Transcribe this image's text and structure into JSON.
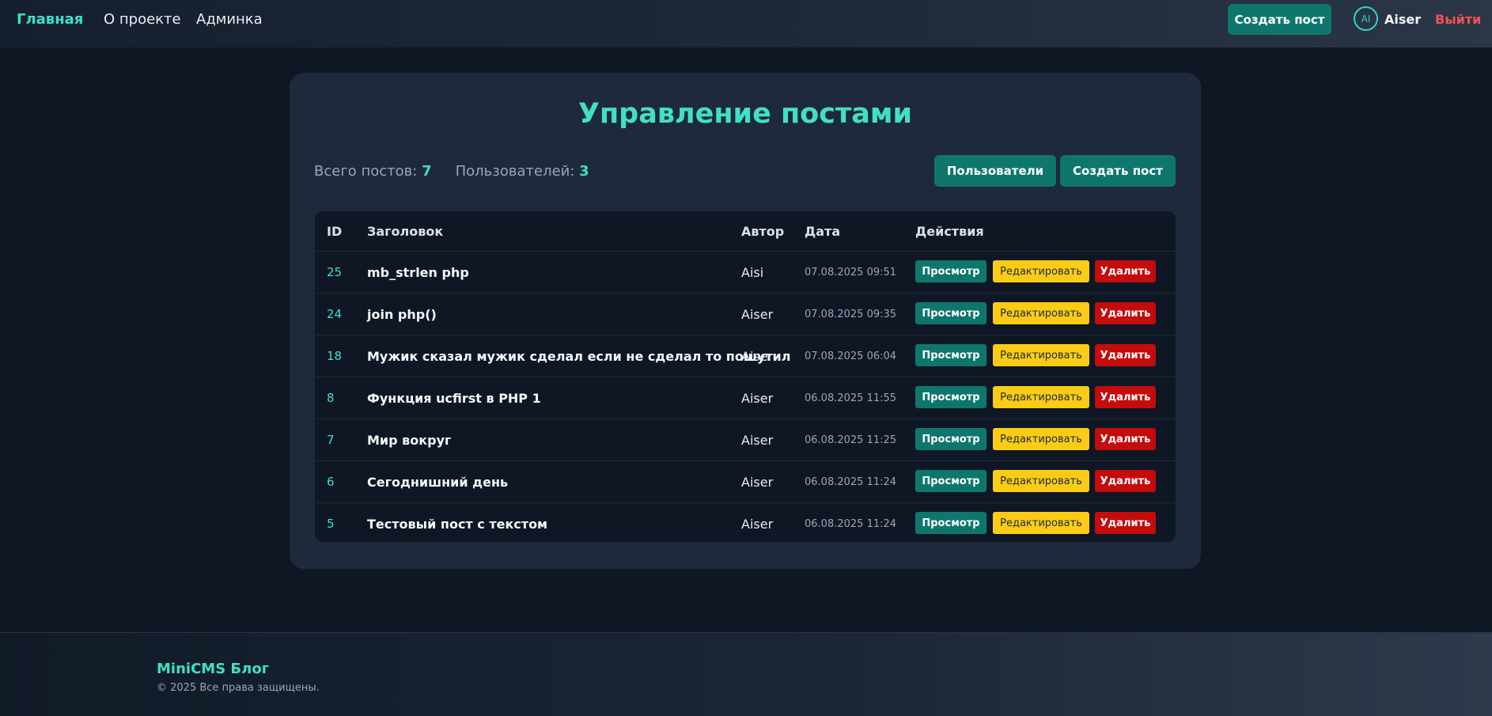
{
  "nav": {
    "links": [
      "Главная",
      "О проекте",
      "Админка"
    ],
    "create_post": "Создать пост",
    "avatar_initials": "AI",
    "username": "Aiser",
    "logout": "Выйти"
  },
  "main": {
    "title": "Управление постами",
    "stats": {
      "posts_label": "Всего постов:",
      "posts_value": "7",
      "users_label": "Пользователей:",
      "users_value": "3"
    },
    "buttons": {
      "users": "Пользователи",
      "create": "Создать пост"
    },
    "table": {
      "headers": [
        "ID",
        "Заголовок",
        "Автор",
        "Дата",
        "Действия"
      ],
      "actions": {
        "view": "Просмотр",
        "edit": "Редактировать",
        "delete": "Удалить"
      },
      "rows": [
        {
          "id": "25",
          "title": "mb_strlen php",
          "author": "Aisi",
          "date": "07.08.2025 09:51"
        },
        {
          "id": "24",
          "title": "join php()",
          "author": "Aiser",
          "date": "07.08.2025 09:35"
        },
        {
          "id": "18",
          "title": "Мужик сказал мужик сделал если не сделал то пошутил",
          "author": "Aiser",
          "date": "07.08.2025 06:04"
        },
        {
          "id": "8",
          "title": "Функция ucfirst в PHP 1",
          "author": "Aiser",
          "date": "06.08.2025 11:55"
        },
        {
          "id": "7",
          "title": "Мир вокруг",
          "author": "Aiser",
          "date": "06.08.2025 11:25"
        },
        {
          "id": "6",
          "title": "Сегоднишний день",
          "author": "Aiser",
          "date": "06.08.2025 11:24"
        },
        {
          "id": "5",
          "title": "Тестовый пост с текстом",
          "author": "Aiser",
          "date": "06.08.2025 11:24"
        }
      ]
    }
  },
  "footer": {
    "brand": "MiniCMS Блог",
    "copyright": "© 2025 Все права защищены."
  },
  "colors": {
    "accent": "#40e0c8",
    "primary_button": "#0f766e",
    "edit_button": "#facc15",
    "delete_button": "#c40c0c",
    "logout": "#f05252"
  }
}
